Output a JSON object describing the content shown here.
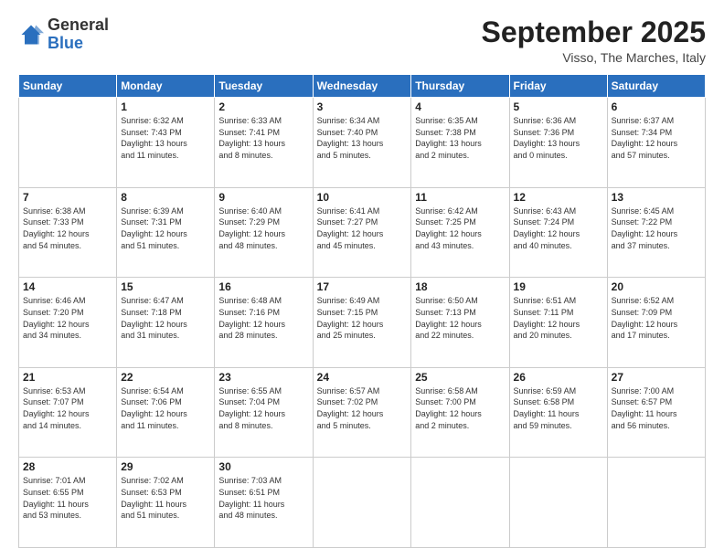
{
  "header": {
    "logo_general": "General",
    "logo_blue": "Blue",
    "month_title": "September 2025",
    "location": "Visso, The Marches, Italy"
  },
  "days_of_week": [
    "Sunday",
    "Monday",
    "Tuesday",
    "Wednesday",
    "Thursday",
    "Friday",
    "Saturday"
  ],
  "weeks": [
    [
      {
        "day": "",
        "content": ""
      },
      {
        "day": "1",
        "content": "Sunrise: 6:32 AM\nSunset: 7:43 PM\nDaylight: 13 hours\nand 11 minutes."
      },
      {
        "day": "2",
        "content": "Sunrise: 6:33 AM\nSunset: 7:41 PM\nDaylight: 13 hours\nand 8 minutes."
      },
      {
        "day": "3",
        "content": "Sunrise: 6:34 AM\nSunset: 7:40 PM\nDaylight: 13 hours\nand 5 minutes."
      },
      {
        "day": "4",
        "content": "Sunrise: 6:35 AM\nSunset: 7:38 PM\nDaylight: 13 hours\nand 2 minutes."
      },
      {
        "day": "5",
        "content": "Sunrise: 6:36 AM\nSunset: 7:36 PM\nDaylight: 13 hours\nand 0 minutes."
      },
      {
        "day": "6",
        "content": "Sunrise: 6:37 AM\nSunset: 7:34 PM\nDaylight: 12 hours\nand 57 minutes."
      }
    ],
    [
      {
        "day": "7",
        "content": "Sunrise: 6:38 AM\nSunset: 7:33 PM\nDaylight: 12 hours\nand 54 minutes."
      },
      {
        "day": "8",
        "content": "Sunrise: 6:39 AM\nSunset: 7:31 PM\nDaylight: 12 hours\nand 51 minutes."
      },
      {
        "day": "9",
        "content": "Sunrise: 6:40 AM\nSunset: 7:29 PM\nDaylight: 12 hours\nand 48 minutes."
      },
      {
        "day": "10",
        "content": "Sunrise: 6:41 AM\nSunset: 7:27 PM\nDaylight: 12 hours\nand 45 minutes."
      },
      {
        "day": "11",
        "content": "Sunrise: 6:42 AM\nSunset: 7:25 PM\nDaylight: 12 hours\nand 43 minutes."
      },
      {
        "day": "12",
        "content": "Sunrise: 6:43 AM\nSunset: 7:24 PM\nDaylight: 12 hours\nand 40 minutes."
      },
      {
        "day": "13",
        "content": "Sunrise: 6:45 AM\nSunset: 7:22 PM\nDaylight: 12 hours\nand 37 minutes."
      }
    ],
    [
      {
        "day": "14",
        "content": "Sunrise: 6:46 AM\nSunset: 7:20 PM\nDaylight: 12 hours\nand 34 minutes."
      },
      {
        "day": "15",
        "content": "Sunrise: 6:47 AM\nSunset: 7:18 PM\nDaylight: 12 hours\nand 31 minutes."
      },
      {
        "day": "16",
        "content": "Sunrise: 6:48 AM\nSunset: 7:16 PM\nDaylight: 12 hours\nand 28 minutes."
      },
      {
        "day": "17",
        "content": "Sunrise: 6:49 AM\nSunset: 7:15 PM\nDaylight: 12 hours\nand 25 minutes."
      },
      {
        "day": "18",
        "content": "Sunrise: 6:50 AM\nSunset: 7:13 PM\nDaylight: 12 hours\nand 22 minutes."
      },
      {
        "day": "19",
        "content": "Sunrise: 6:51 AM\nSunset: 7:11 PM\nDaylight: 12 hours\nand 20 minutes."
      },
      {
        "day": "20",
        "content": "Sunrise: 6:52 AM\nSunset: 7:09 PM\nDaylight: 12 hours\nand 17 minutes."
      }
    ],
    [
      {
        "day": "21",
        "content": "Sunrise: 6:53 AM\nSunset: 7:07 PM\nDaylight: 12 hours\nand 14 minutes."
      },
      {
        "day": "22",
        "content": "Sunrise: 6:54 AM\nSunset: 7:06 PM\nDaylight: 12 hours\nand 11 minutes."
      },
      {
        "day": "23",
        "content": "Sunrise: 6:55 AM\nSunset: 7:04 PM\nDaylight: 12 hours\nand 8 minutes."
      },
      {
        "day": "24",
        "content": "Sunrise: 6:57 AM\nSunset: 7:02 PM\nDaylight: 12 hours\nand 5 minutes."
      },
      {
        "day": "25",
        "content": "Sunrise: 6:58 AM\nSunset: 7:00 PM\nDaylight: 12 hours\nand 2 minutes."
      },
      {
        "day": "26",
        "content": "Sunrise: 6:59 AM\nSunset: 6:58 PM\nDaylight: 11 hours\nand 59 minutes."
      },
      {
        "day": "27",
        "content": "Sunrise: 7:00 AM\nSunset: 6:57 PM\nDaylight: 11 hours\nand 56 minutes."
      }
    ],
    [
      {
        "day": "28",
        "content": "Sunrise: 7:01 AM\nSunset: 6:55 PM\nDaylight: 11 hours\nand 53 minutes."
      },
      {
        "day": "29",
        "content": "Sunrise: 7:02 AM\nSunset: 6:53 PM\nDaylight: 11 hours\nand 51 minutes."
      },
      {
        "day": "30",
        "content": "Sunrise: 7:03 AM\nSunset: 6:51 PM\nDaylight: 11 hours\nand 48 minutes."
      },
      {
        "day": "",
        "content": ""
      },
      {
        "day": "",
        "content": ""
      },
      {
        "day": "",
        "content": ""
      },
      {
        "day": "",
        "content": ""
      }
    ]
  ]
}
